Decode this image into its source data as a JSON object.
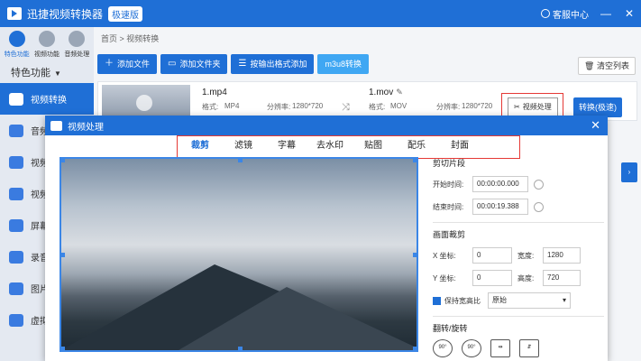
{
  "app": {
    "title": "迅捷视频转换器",
    "badge": "极速版",
    "support": "客服中心",
    "controls": [
      "—",
      "✕"
    ]
  },
  "topnav": [
    {
      "label": "特色功能",
      "active": true
    },
    {
      "label": "视频功能",
      "active": false
    },
    {
      "label": "音频处理",
      "active": false
    }
  ],
  "sidebar": {
    "section": "特色功能",
    "items": [
      {
        "label": "视频转换",
        "active": true
      },
      {
        "label": "音频",
        "active": false
      },
      {
        "label": "视频",
        "active": false
      },
      {
        "label": "视频",
        "active": false
      },
      {
        "label": "屏幕",
        "active": false
      },
      {
        "label": "录音",
        "active": false
      },
      {
        "label": "图片",
        "active": false
      },
      {
        "label": "虚拟",
        "active": false
      }
    ]
  },
  "main": {
    "breadcrumb": "首页  >  视频转换",
    "toolbar": {
      "add_file": "添加文件",
      "add_folder": "添加文件夹",
      "by_format": "按输出格式添加",
      "m3u8": "m3u8转换",
      "clear": "清空列表"
    },
    "file": {
      "src_name": "1.mp4",
      "src_format_label": "格式:",
      "src_format": "MP4",
      "src_res_label": "分辨率:",
      "src_res": "1280*720",
      "dst_name": "1.mov",
      "dst_format_label": "格式:",
      "dst_format": "MOV",
      "dst_res_label": "分辨率:",
      "dst_res": "1280*720",
      "process_btn": "视频处理",
      "convert_btn": "转换(极速)"
    }
  },
  "dialog": {
    "title": "视频处理",
    "tabs": [
      {
        "label": "裁剪",
        "active": true
      },
      {
        "label": "滤镜",
        "active": false
      },
      {
        "label": "字幕",
        "active": false
      },
      {
        "label": "去水印",
        "active": false
      },
      {
        "label": "贴图",
        "active": false
      },
      {
        "label": "配乐",
        "active": false
      },
      {
        "label": "封面",
        "active": false
      }
    ],
    "clip": {
      "title": "剪切片段",
      "start_label": "开始时间:",
      "start": "00:00:00.000",
      "end_label": "结束时间:",
      "end": "00:00:19.388"
    },
    "crop": {
      "title": "画面裁剪",
      "x_label": "X 坐标:",
      "x": "0",
      "w_label": "宽度:",
      "w": "1280",
      "y_label": "Y 坐标:",
      "y": "0",
      "h_label": "高度:",
      "h": "720",
      "keep_ratio": "保持宽高比",
      "ratio": "原始"
    },
    "rotate": {
      "title": "翻转/旋转",
      "buttons": [
        "90°",
        "90°"
      ]
    }
  }
}
